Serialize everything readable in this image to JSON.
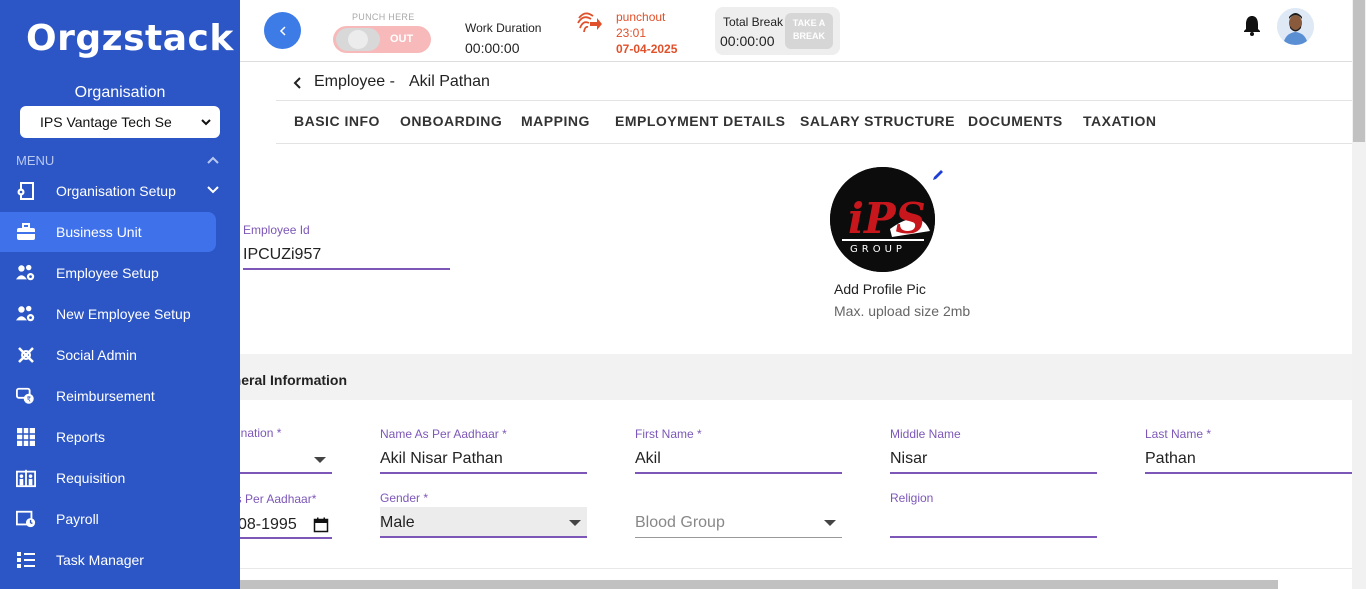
{
  "app": {
    "logo_text": "Orgzstack"
  },
  "sidebar": {
    "org_title": "Organisation",
    "org_selected": "IPS Vantage Tech Se",
    "menu_label": "MENU",
    "items": [
      {
        "label": "Organisation Setup",
        "icon": "gear-building-icon",
        "active": false
      },
      {
        "label": "Business Unit",
        "icon": "briefcase-icon",
        "active": true
      },
      {
        "label": "Employee Setup",
        "icon": "users-gear-icon",
        "active": false
      },
      {
        "label": "New Employee Setup",
        "icon": "users-gear-icon",
        "active": false
      },
      {
        "label": "Social Admin",
        "icon": "network-icon",
        "active": false
      },
      {
        "label": "Reimbursement",
        "icon": "money-refresh-icon",
        "active": false
      },
      {
        "label": "Reports",
        "icon": "grid-report-icon",
        "active": false
      },
      {
        "label": "Requisition",
        "icon": "requisition-icon",
        "active": false
      },
      {
        "label": "Payroll",
        "icon": "payroll-icon",
        "active": false
      },
      {
        "label": "Task Manager",
        "icon": "task-list-icon",
        "active": false
      }
    ]
  },
  "topbar": {
    "punch_here": "PUNCH HERE",
    "punch_state": "OUT",
    "work_duration_label": "Work Duration",
    "work_duration": "00:00:00",
    "punchout_label": "punchout",
    "punchout_time": "23:01",
    "punchout_date": "07-04-2025",
    "total_break_label": "Total Break",
    "total_break": "00:00:00",
    "take_break_line1": "TAKE A",
    "take_break_line2": "BREAK"
  },
  "breadcrumb": {
    "section": "Employee -",
    "name": "Akil Pathan"
  },
  "tabs": [
    "BASIC INFO",
    "ONBOARDING",
    "MAPPING",
    "EMPLOYMENT DETAILS",
    "SALARY STRUCTURE",
    "DOCUMENTS",
    "TAXATION"
  ],
  "profile": {
    "employee_id_label": "Employee Id",
    "employee_id": "IPCUZi957",
    "add_pic": "Add Profile Pic",
    "max_size": "Max. upload size 2mb",
    "pic_logo_text": "iPS",
    "pic_logo_sub": "GROUP"
  },
  "general": {
    "title": "General Information",
    "designation_label": "Designation *",
    "name_aadhaar_label": "Name As Per Aadhaar *",
    "name_aadhaar": "Akil Nisar Pathan",
    "first_name_label": "First Name *",
    "first_name": "Akil",
    "middle_name_label": "Middle Name",
    "middle_name": "Nisar",
    "last_name_label": "Last Name *",
    "last_name": "Pathan",
    "dob_label": "DOB As Per Aadhaar*",
    "dob": "08-1995",
    "gender_label": "Gender *",
    "gender": "Male",
    "blood_group_placeholder": "Blood Group",
    "religion_label": "Religion",
    "religion": ""
  },
  "colors": {
    "sidebar_bg": "#2c56c5",
    "active_item": "#3f71ea",
    "accent_purple": "#7d57b8",
    "punchout_orange": "#e0502a"
  }
}
